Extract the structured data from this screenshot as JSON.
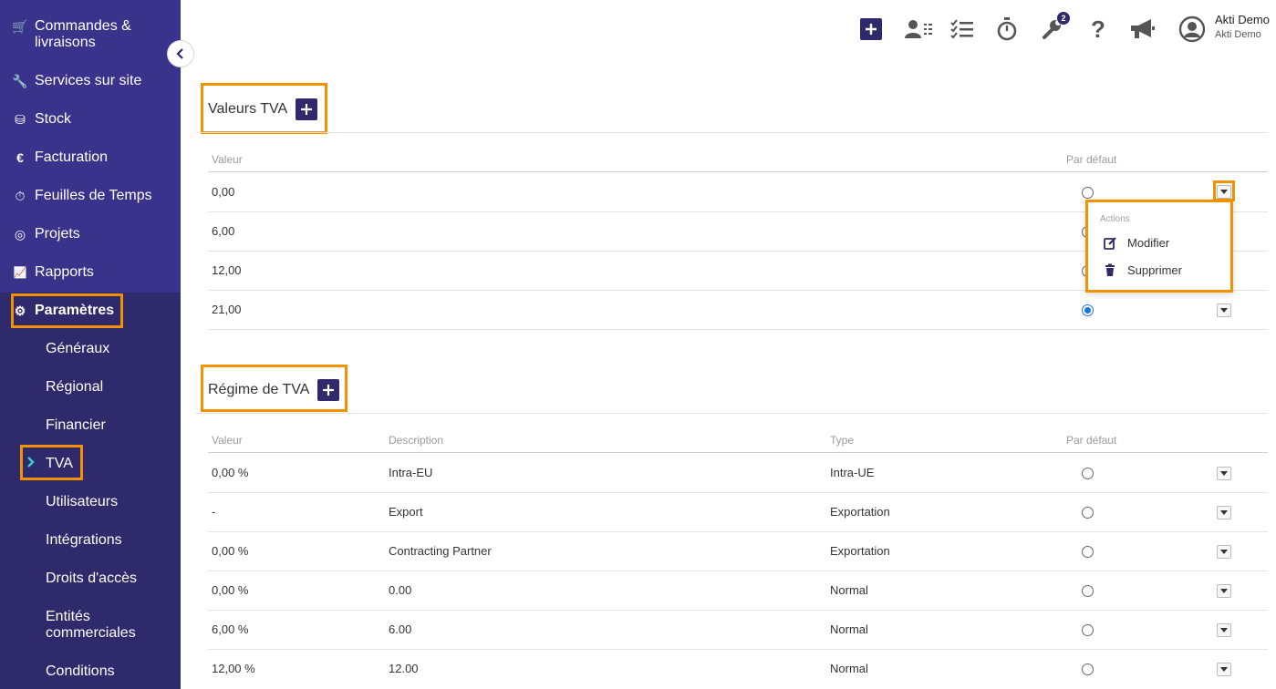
{
  "sidebar": {
    "items": [
      {
        "label": "Commandes &",
        "label2": "livraisons",
        "icon": "cart-icon"
      },
      {
        "label": "Services sur site",
        "icon": "wrench-icon"
      },
      {
        "label": "Stock",
        "icon": "boxes-icon"
      },
      {
        "label": "Facturation",
        "icon": "euro-icon"
      },
      {
        "label": "Feuilles de Temps",
        "icon": "stopwatch-icon"
      },
      {
        "label": "Projets",
        "icon": "target-icon"
      },
      {
        "label": "Rapports",
        "icon": "chart-line-icon"
      },
      {
        "label": "Paramètres",
        "icon": "gear-icon"
      }
    ],
    "icons": {
      "cart": "🛒",
      "wrench": "🔧",
      "boxes": "⛁",
      "euro": "€",
      "stopwatch": "⏱",
      "target": "◎",
      "chart": "📈",
      "gear": "⚙"
    },
    "subitems": [
      "Généraux",
      "Régional",
      "Financier",
      "TVA",
      "Utilisateurs",
      "Intégrations",
      "Droits d'accès",
      "Entités",
      "commerciales",
      "Conditions"
    ]
  },
  "topbar": {
    "icons": [
      "add-icon",
      "contacts-icon",
      "tasks-icon",
      "stopwatch-icon",
      "tools-icon",
      "help-icon",
      "megaphone-icon",
      "user-avatar-icon"
    ],
    "tools_badge": "2",
    "help_glyph": "?",
    "user_name": "Akti Demo",
    "user_company": "Akti Demo"
  },
  "vat_values": {
    "title": "Valeurs TVA",
    "columns": {
      "value": "Valeur",
      "default": "Par défaut"
    },
    "rows": [
      {
        "value": "0,00",
        "default": false
      },
      {
        "value": "6,00",
        "default": false
      },
      {
        "value": "12,00",
        "default": false
      },
      {
        "value": "21,00",
        "default": true
      }
    ]
  },
  "dropdown_menu": {
    "header": "Actions",
    "items": [
      {
        "label": "Modifier",
        "icon": "edit-icon"
      },
      {
        "label": "Supprimer",
        "icon": "trash-icon"
      }
    ]
  },
  "vat_regimes": {
    "title": "Régime de TVA",
    "columns": {
      "value": "Valeur",
      "description": "Description",
      "type": "Type",
      "default": "Par défaut"
    },
    "rows": [
      {
        "value": "0,00 %",
        "description": "Intra-EU",
        "type": "Intra-UE",
        "default": false
      },
      {
        "value": "-",
        "description": "Export",
        "type": "Exportation",
        "default": false
      },
      {
        "value": "0,00 %",
        "description": "Contracting Partner",
        "type": "Exportation",
        "default": false
      },
      {
        "value": "0,00 %",
        "description": "0.00",
        "type": "Normal",
        "default": false
      },
      {
        "value": "6,00 %",
        "description": "6.00",
        "type": "Normal",
        "default": false
      },
      {
        "value": "12,00 %",
        "description": "12.00",
        "type": "Normal",
        "default": false
      }
    ]
  },
  "colors": {
    "sidebar_bg": "#2f2a6b",
    "sidebar_top_bg": "#3a338c",
    "highlight": "#f39200",
    "accent": "#2f2a6b",
    "radio_checked": "#1a73e8"
  }
}
